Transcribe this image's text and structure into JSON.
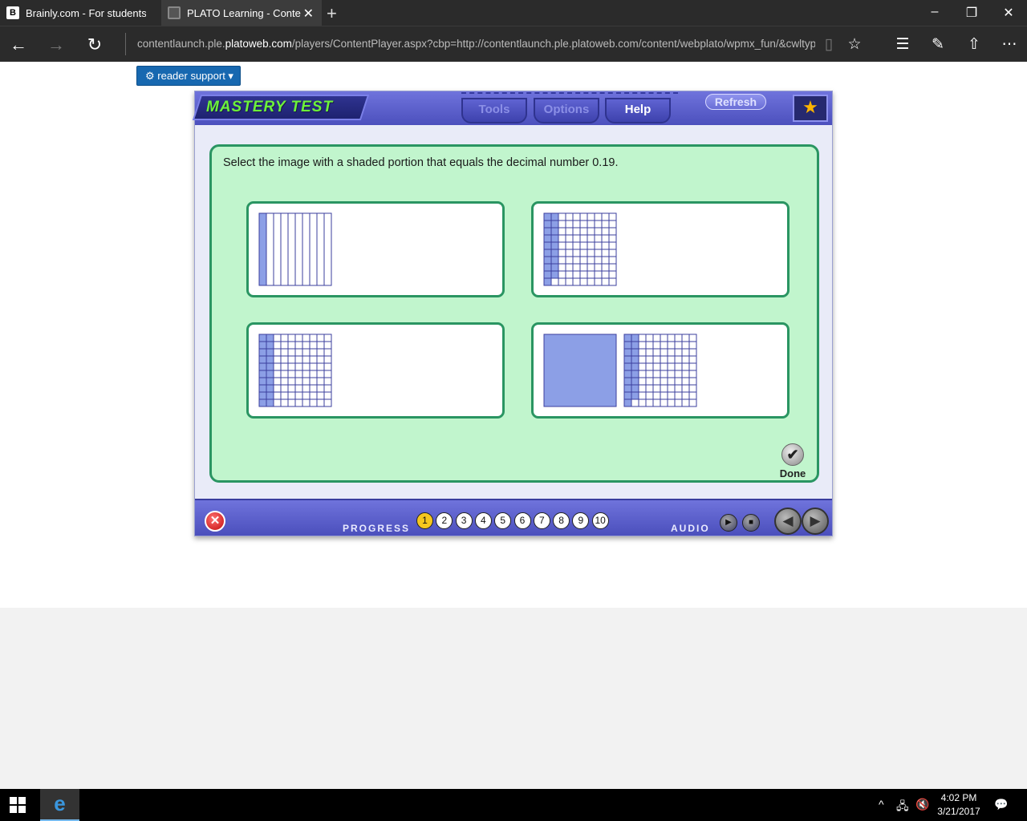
{
  "browser": {
    "tabs": [
      {
        "label": "Brainly.com - For students. I",
        "favicon": "B",
        "active": false
      },
      {
        "label": "PLATO Learning - Conte",
        "active": true
      }
    ],
    "new_tab": "+",
    "window_controls": {
      "minimize": "–",
      "restore": "❐",
      "close": "✕"
    },
    "nav": {
      "back": "←",
      "forward": "→",
      "refresh": "↻"
    },
    "address": {
      "prefix": "contentlaunch.ple.",
      "domain": "platoweb.com",
      "suffix": "/players/ContentPlayer.aspx?cbp=http://contentlaunch.ple.platoweb.com/content/webplato/wpmx_fun/&cwltype"
    },
    "toolbar_icons": [
      "reading-view-icon",
      "favorite-star-icon",
      "hub-icon",
      "web-note-icon",
      "share-icon",
      "more-icon"
    ]
  },
  "reader_support": {
    "label": "⚙ reader support ▾"
  },
  "player": {
    "title": "MASTERY TEST",
    "menu": {
      "tools": "Tools",
      "options": "Options",
      "help": "Help"
    },
    "refresh": "Refresh",
    "star": "★",
    "question": "Select the image with a shaded portion that equals the decimal number 0.19.",
    "choices": [
      {
        "id": "A",
        "model": "tenths-strip",
        "shaded_tenths": 1
      },
      {
        "id": "B",
        "model": "hundreds-grid",
        "shaded_hundredths": 19
      },
      {
        "id": "C",
        "model": "hundreds-grid",
        "shaded_hundredths": 20
      },
      {
        "id": "D",
        "model": "whole-plus-hundreds-grid",
        "shaded_wholes": 1,
        "shaded_hundredths": 19
      }
    ],
    "done": {
      "icon": "✔",
      "label": "Done"
    },
    "bottom": {
      "exit": "✕",
      "progress_label": "PROGRESS",
      "progress_items": [
        "1",
        "2",
        "3",
        "4",
        "5",
        "6",
        "7",
        "8",
        "9",
        "10"
      ],
      "current_item": "1",
      "audio_label": "AUDIO",
      "play": "▶",
      "stop": "■",
      "prev": "◀",
      "next": "▶"
    }
  },
  "colors": {
    "shade": "#8c9fe6",
    "grid_line": "#3b3f9e",
    "panel": "#c1f5cd",
    "panel_border": "#2a9562"
  },
  "taskbar": {
    "edge": "e",
    "tray": [
      "^",
      "🖧",
      "🔇",
      "💬"
    ],
    "time": "4:02 PM",
    "date": "3/21/2017"
  }
}
